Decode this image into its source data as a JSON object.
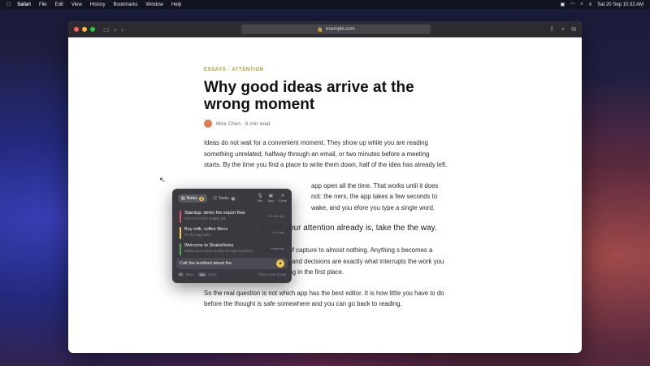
{
  "menubar": {
    "apple": "",
    "items": [
      "Safari",
      "File",
      "Edit",
      "View",
      "History",
      "Bookmarks",
      "Window",
      "Help"
    ],
    "datetime": "Sat 20 Sep  10:32 AM"
  },
  "browser": {
    "url": "example.com"
  },
  "article": {
    "kicker": "ESSAYS · ATTENTION",
    "title": "Why good ideas arrive at the wrong moment",
    "author": "Mira Chen · 6 min read",
    "p1": "Ideas do not wait for a convenient moment. They show up while you are reading something unrelated, halfway through an email, or two minutes before a meeting starts. By the time you find a place to write them down, half of the idea has already left.",
    "p2": "app open all the time. That works until it does not: the ners, the app takes a few seconds to wake, and you efore you type a single word.",
    "p3": "where your attention already is, take the the way.",
    "p4": "the cost of capture to almost nothing. Anything s becomes a decision, and decisions are exactly what interrupts the work you were doing in the first place.",
    "p5": "So the real question is not which app has the best editor. It is how little you have to do before the thought is safe somewhere and you can go back to reading."
  },
  "popup": {
    "tabs": [
      {
        "label": "Notes",
        "count": "3"
      },
      {
        "label": "Tasks",
        "count": "0"
      }
    ],
    "actions": [
      {
        "label": "Mic",
        "icon": "🎙"
      },
      {
        "label": "App",
        "icon": "▣"
      },
      {
        "label": "Close",
        "icon": "✕"
      }
    ],
    "notes": [
      {
        "title": "Standup: demo the export flow",
        "sub": "Ask PJ's for the staging link",
        "time": "10 min ago",
        "color": "#e0506a"
      },
      {
        "title": "Buy milk, coffee filters",
        "sub": "On the way home",
        "time": "1 hr ago",
        "color": "#f2c94c"
      },
      {
        "title": "Welcome to ShakeNotes",
        "sub": "Shake your mouse quickly left-right anywhere",
        "time": "Yesterday",
        "color": "#4caf50"
      }
    ],
    "input_value": "Call the landlord about the",
    "footer": {
      "save_key": "↵",
      "save_label": "Save",
      "close_key": "esc",
      "close_label": "Close",
      "hint": "Click a note to edit"
    }
  }
}
